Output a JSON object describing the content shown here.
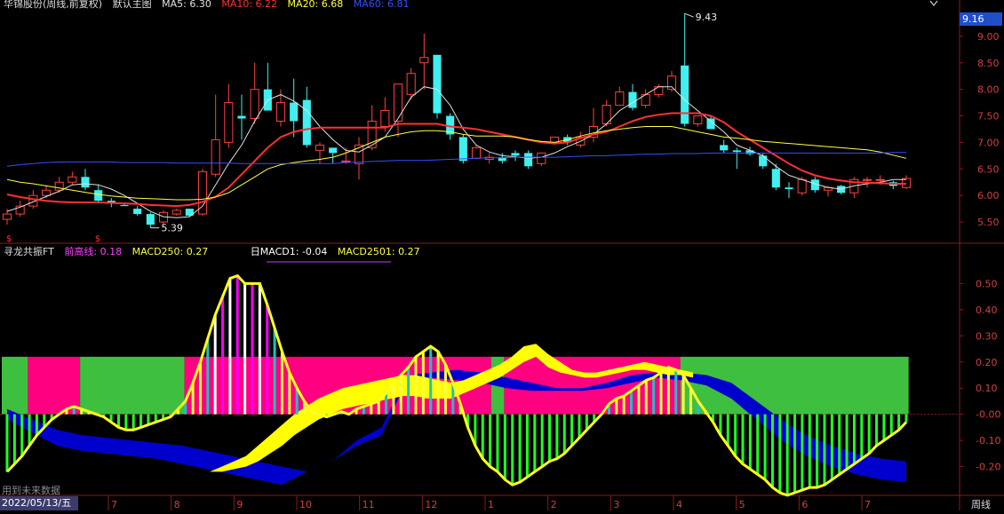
{
  "header": {
    "stock_title": "华锦股份(周线,前复权)",
    "template": "默认主图",
    "ma5": {
      "label": "MA5:",
      "value": "6.30",
      "color": "#e0e0e0"
    },
    "ma10": {
      "label": "MA10:",
      "value": "6.22",
      "color": "#ff3030"
    },
    "ma20": {
      "label": "MA20:",
      "value": "6.68",
      "color": "#ffff40"
    },
    "ma60": {
      "label": "MA60:",
      "value": "6.81",
      "color": "#3050ff"
    }
  },
  "indicator_header": {
    "name": "寻龙共振FT",
    "prev_high": {
      "label": "前高线:",
      "value": "0.18",
      "color": "#ff40ff"
    },
    "macd250": {
      "label": "MACD250:",
      "value": "0.27",
      "color": "#ffff40"
    },
    "day_macd1": {
      "label": "日MACD1:",
      "value": "-0.04",
      "color": "#ffffff"
    },
    "macd2501": {
      "label": "MACD2501:",
      "value": "0.27",
      "color": "#ffff40"
    }
  },
  "price_badge": "9.16",
  "axis_title": "周线",
  "date_box": "2022/05/13/五",
  "future_note": "用到未来数据",
  "marker_s": "$",
  "month_labels": [
    "7",
    "8",
    "9",
    "10",
    "11",
    "12",
    "1",
    "2",
    "3",
    "4",
    "5",
    "6",
    "7"
  ],
  "chart_data": [
    {
      "type": "candlestick",
      "y_ticks": [
        "5.50",
        "6.00",
        "6.50",
        "7.00",
        "7.50",
        "8.00",
        "8.50",
        "9.00"
      ],
      "ylim": [
        5.2,
        9.55
      ],
      "annotations": [
        {
          "text": "9.43",
          "value": 9.43
        },
        {
          "text": "5.39",
          "value": 5.39
        }
      ],
      "candles": [
        {
          "o": 5.55,
          "h": 5.75,
          "l": 5.45,
          "c": 5.65
        },
        {
          "o": 5.65,
          "h": 5.9,
          "l": 5.6,
          "c": 5.8
        },
        {
          "o": 5.8,
          "h": 6.1,
          "l": 5.75,
          "c": 6.0
        },
        {
          "o": 6.0,
          "h": 6.2,
          "l": 5.95,
          "c": 6.1
        },
        {
          "o": 6.1,
          "h": 6.35,
          "l": 6.05,
          "c": 6.25
        },
        {
          "o": 6.25,
          "h": 6.45,
          "l": 6.2,
          "c": 6.35
        },
        {
          "o": 6.35,
          "h": 6.5,
          "l": 6.1,
          "c": 6.15
        },
        {
          "o": 6.1,
          "h": 6.2,
          "l": 5.85,
          "c": 5.9
        },
        {
          "o": 5.9,
          "h": 5.95,
          "l": 5.78,
          "c": 5.85
        },
        {
          "o": 5.82,
          "h": 5.85,
          "l": 5.8,
          "c": 5.8
        },
        {
          "o": 5.75,
          "h": 5.8,
          "l": 5.62,
          "c": 5.65
        },
        {
          "o": 5.65,
          "h": 5.68,
          "l": 5.39,
          "c": 5.45
        },
        {
          "o": 5.5,
          "h": 5.72,
          "l": 5.45,
          "c": 5.68
        },
        {
          "o": 5.65,
          "h": 5.75,
          "l": 5.62,
          "c": 5.72
        },
        {
          "o": 5.75,
          "h": 5.75,
          "l": 5.6,
          "c": 5.62
        },
        {
          "o": 5.65,
          "h": 6.5,
          "l": 5.62,
          "c": 6.45
        },
        {
          "o": 6.4,
          "h": 7.9,
          "l": 6.35,
          "c": 7.05
        },
        {
          "o": 7.0,
          "h": 8.1,
          "l": 6.9,
          "c": 7.75
        },
        {
          "o": 7.5,
          "h": 7.9,
          "l": 7.05,
          "c": 7.45
        },
        {
          "o": 7.45,
          "h": 8.5,
          "l": 7.35,
          "c": 8.0
        },
        {
          "o": 8.0,
          "h": 8.5,
          "l": 7.6,
          "c": 7.6
        },
        {
          "o": 7.4,
          "h": 8.0,
          "l": 7.3,
          "c": 7.75
        },
        {
          "o": 7.75,
          "h": 8.2,
          "l": 7.1,
          "c": 7.4
        },
        {
          "o": 7.8,
          "h": 8.05,
          "l": 6.9,
          "c": 6.95
        },
        {
          "o": 6.85,
          "h": 7.0,
          "l": 6.6,
          "c": 6.95
        },
        {
          "o": 6.9,
          "h": 6.9,
          "l": 6.6,
          "c": 6.8
        },
        {
          "o": 6.65,
          "h": 6.9,
          "l": 6.6,
          "c": 6.65
        },
        {
          "o": 6.6,
          "h": 7.1,
          "l": 6.3,
          "c": 6.95
        },
        {
          "o": 6.9,
          "h": 7.7,
          "l": 6.85,
          "c": 7.4
        },
        {
          "o": 7.3,
          "h": 7.85,
          "l": 7.2,
          "c": 7.6
        },
        {
          "o": 7.4,
          "h": 8.1,
          "l": 7.1,
          "c": 8.1
        },
        {
          "o": 7.9,
          "h": 8.4,
          "l": 7.8,
          "c": 8.3
        },
        {
          "o": 8.5,
          "h": 9.05,
          "l": 8.0,
          "c": 8.6
        },
        {
          "o": 8.65,
          "h": 8.65,
          "l": 7.45,
          "c": 7.55
        },
        {
          "o": 7.5,
          "h": 7.55,
          "l": 7.05,
          "c": 7.15
        },
        {
          "o": 7.1,
          "h": 7.15,
          "l": 6.6,
          "c": 6.65
        },
        {
          "o": 6.7,
          "h": 6.95,
          "l": 6.68,
          "c": 6.9
        },
        {
          "o": 6.68,
          "h": 6.8,
          "l": 6.6,
          "c": 6.72
        },
        {
          "o": 6.72,
          "h": 6.8,
          "l": 6.6,
          "c": 6.65
        },
        {
          "o": 6.8,
          "h": 6.85,
          "l": 6.65,
          "c": 6.75
        },
        {
          "o": 6.8,
          "h": 6.85,
          "l": 6.5,
          "c": 6.55
        },
        {
          "o": 6.6,
          "h": 6.8,
          "l": 6.55,
          "c": 6.8
        },
        {
          "o": 7.0,
          "h": 7.1,
          "l": 6.95,
          "c": 7.1
        },
        {
          "o": 7.1,
          "h": 7.15,
          "l": 6.95,
          "c": 7.0
        },
        {
          "o": 6.95,
          "h": 7.2,
          "l": 6.9,
          "c": 7.1
        },
        {
          "o": 7.1,
          "h": 7.65,
          "l": 7.0,
          "c": 7.3
        },
        {
          "o": 7.35,
          "h": 7.8,
          "l": 7.3,
          "c": 7.7
        },
        {
          "o": 7.7,
          "h": 8.05,
          "l": 7.7,
          "c": 7.95
        },
        {
          "o": 7.95,
          "h": 8.1,
          "l": 7.6,
          "c": 7.65
        },
        {
          "o": 7.7,
          "h": 8.0,
          "l": 7.65,
          "c": 7.9
        },
        {
          "o": 7.9,
          "h": 8.1,
          "l": 7.85,
          "c": 8.05
        },
        {
          "o": 8.0,
          "h": 8.35,
          "l": 7.95,
          "c": 8.25
        },
        {
          "o": 8.45,
          "h": 9.43,
          "l": 7.3,
          "c": 7.35
        },
        {
          "o": 7.35,
          "h": 7.5,
          "l": 7.3,
          "c": 7.5
        },
        {
          "o": 7.45,
          "h": 7.5,
          "l": 7.25,
          "c": 7.25
        },
        {
          "o": 6.95,
          "h": 7.05,
          "l": 6.8,
          "c": 6.85
        },
        {
          "o": 6.85,
          "h": 6.9,
          "l": 6.5,
          "c": 6.82
        },
        {
          "o": 6.85,
          "h": 6.92,
          "l": 6.75,
          "c": 6.78
        },
        {
          "o": 6.75,
          "h": 6.8,
          "l": 6.5,
          "c": 6.55
        },
        {
          "o": 6.5,
          "h": 6.6,
          "l": 6.1,
          "c": 6.15
        },
        {
          "o": 6.15,
          "h": 6.25,
          "l": 5.95,
          "c": 6.12
        },
        {
          "o": 6.05,
          "h": 6.35,
          "l": 6.0,
          "c": 6.3
        },
        {
          "o": 6.3,
          "h": 6.35,
          "l": 6.05,
          "c": 6.1
        },
        {
          "o": 6.1,
          "h": 6.18,
          "l": 5.98,
          "c": 6.15
        },
        {
          "o": 6.18,
          "h": 6.2,
          "l": 6.02,
          "c": 6.05
        },
        {
          "o": 6.05,
          "h": 6.35,
          "l": 5.95,
          "c": 6.3
        },
        {
          "o": 6.3,
          "h": 6.35,
          "l": 6.15,
          "c": 6.3
        },
        {
          "o": 6.3,
          "h": 6.38,
          "l": 6.2,
          "c": 6.3
        },
        {
          "o": 6.25,
          "h": 6.28,
          "l": 6.12,
          "c": 6.18
        },
        {
          "o": 6.15,
          "h": 6.38,
          "l": 6.12,
          "c": 6.32
        }
      ],
      "series": [
        {
          "name": "MA5",
          "color": "#e0e0e0",
          "values": [
            5.7,
            5.78,
            5.88,
            5.98,
            6.08,
            6.2,
            6.22,
            6.2,
            6.12,
            6.0,
            5.85,
            5.7,
            5.6,
            5.58,
            5.6,
            5.8,
            6.2,
            6.6,
            6.95,
            7.4,
            7.8,
            7.9,
            7.78,
            7.6,
            7.3,
            7.05,
            6.85,
            6.82,
            6.95,
            7.1,
            7.45,
            7.85,
            8.05,
            8.0,
            7.7,
            7.25,
            6.95,
            6.82,
            6.75,
            6.73,
            6.7,
            6.72,
            6.8,
            6.92,
            7.02,
            7.15,
            7.35,
            7.6,
            7.75,
            7.9,
            8.05,
            8.05,
            7.8,
            7.6,
            7.4,
            7.2,
            6.95,
            6.85,
            6.75,
            6.55,
            6.38,
            6.3,
            6.22,
            6.15,
            6.12,
            6.18,
            6.22,
            6.25,
            6.3,
            6.3
          ]
        },
        {
          "name": "MA10",
          "color": "#ff3030",
          "values": [
            6.02,
            5.97,
            5.93,
            5.9,
            5.88,
            5.87,
            5.87,
            5.87,
            5.86,
            5.85,
            5.84,
            5.82,
            5.81,
            5.8,
            5.82,
            5.88,
            5.98,
            6.15,
            6.4,
            6.65,
            6.9,
            7.1,
            7.2,
            7.25,
            7.28,
            7.28,
            7.28,
            7.28,
            7.28,
            7.28,
            7.35,
            7.35,
            7.35,
            7.35,
            7.3,
            7.28,
            7.25,
            7.2,
            7.15,
            7.1,
            7.05,
            7.0,
            6.98,
            7.0,
            7.08,
            7.15,
            7.2,
            7.3,
            7.4,
            7.48,
            7.52,
            7.55,
            7.55,
            7.55,
            7.5,
            7.38,
            7.2,
            7.05,
            6.9,
            6.75,
            6.6,
            6.47,
            6.38,
            6.32,
            6.28,
            6.25,
            6.24,
            6.23,
            6.22,
            6.22
          ]
        },
        {
          "name": "MA20",
          "color": "#ffff40",
          "values": [
            6.3,
            6.25,
            6.22,
            6.18,
            6.14,
            6.1,
            6.06,
            6.02,
            5.99,
            5.97,
            5.95,
            5.94,
            5.93,
            5.92,
            5.92,
            5.93,
            5.97,
            6.05,
            6.2,
            6.35,
            6.5,
            6.58,
            6.62,
            6.65,
            6.68,
            6.72,
            6.8,
            6.9,
            7.0,
            7.1,
            7.15,
            7.2,
            7.22,
            7.22,
            7.2,
            7.15,
            7.12,
            7.12,
            7.12,
            7.1,
            7.05,
            7.02,
            7.0,
            7.05,
            7.12,
            7.18,
            7.22,
            7.25,
            7.28,
            7.3,
            7.3,
            7.3,
            7.25,
            7.2,
            7.15,
            7.1,
            7.08,
            7.05,
            7.02,
            7.0,
            6.98,
            6.96,
            6.94,
            6.92,
            6.9,
            6.88,
            6.86,
            6.82,
            6.76,
            6.7
          ]
        },
        {
          "name": "MA60",
          "color": "#3050ff",
          "values": [
            6.55,
            6.58,
            6.6,
            6.62,
            6.63,
            6.63,
            6.63,
            6.63,
            6.63,
            6.62,
            6.62,
            6.62,
            6.62,
            6.61,
            6.61,
            6.61,
            6.61,
            6.61,
            6.6,
            6.6,
            6.6,
            6.6,
            6.6,
            6.6,
            6.6,
            6.6,
            6.62,
            6.63,
            6.64,
            6.65,
            6.66,
            6.66,
            6.66,
            6.67,
            6.68,
            6.69,
            6.7,
            6.71,
            6.71,
            6.72,
            6.72,
            6.72,
            6.72,
            6.73,
            6.74,
            6.75,
            6.75,
            6.76,
            6.77,
            6.78,
            6.78,
            6.79,
            6.79,
            6.79,
            6.8,
            6.8,
            6.8,
            6.8,
            6.8,
            6.8,
            6.8,
            6.8,
            6.8,
            6.8,
            6.8,
            6.8,
            6.8,
            6.8,
            6.81,
            6.81
          ]
        }
      ]
    },
    {
      "type": "indicator",
      "y_ticks": [
        "0.50",
        "0.40",
        "0.30",
        "0.20",
        "0.10",
        "-0.00",
        "-0.10",
        "-0.20"
      ],
      "ylim": [
        -0.3,
        0.6
      ],
      "bands": [
        {
          "from": 0,
          "to": 4,
          "color": "#3fbf3f"
        },
        {
          "from": 4,
          "to": 12,
          "color": "#ff0080"
        },
        {
          "from": 12,
          "to": 28,
          "color": "#3fbf3f"
        },
        {
          "from": 28,
          "to": 75,
          "color": "#ff0080"
        },
        {
          "from": 75,
          "to": 77,
          "color": "#3fbf3f"
        },
        {
          "from": 77,
          "to": 104,
          "color": "#ff0080"
        },
        {
          "from": 104,
          "to": 139,
          "color": "#3fbf3f"
        }
      ],
      "band_top": 0.22,
      "yellow_line": [
        -0.22,
        -0.19,
        -0.16,
        -0.12,
        -0.08,
        -0.05,
        -0.02,
        0.0,
        0.02,
        0.03,
        0.02,
        0.01,
        0.0,
        -0.01,
        -0.03,
        -0.05,
        -0.06,
        -0.06,
        -0.05,
        -0.04,
        -0.03,
        -0.02,
        -0.01,
        0.02,
        0.05,
        0.12,
        0.2,
        0.29,
        0.38,
        0.45,
        0.52,
        0.53,
        0.5,
        0.5,
        0.5,
        0.42,
        0.33,
        0.24,
        0.16,
        0.1,
        0.05,
        0.01,
        0.0,
        -0.01,
        0.0,
        0.01,
        0.0,
        0.02,
        0.03,
        0.04,
        0.05,
        0.08,
        0.12,
        0.15,
        0.18,
        0.22,
        0.24,
        0.26,
        0.24,
        0.19,
        0.12,
        0.04,
        -0.05,
        -0.12,
        -0.17,
        -0.2,
        -0.22,
        -0.25,
        -0.27,
        -0.26,
        -0.24,
        -0.22,
        -0.2,
        -0.18,
        -0.17,
        -0.15,
        -0.12,
        -0.09,
        -0.06,
        -0.03,
        0.0,
        0.04,
        0.06,
        0.07,
        0.09,
        0.11,
        0.13,
        0.14,
        0.16,
        0.18,
        0.17,
        0.15,
        0.1,
        0.05,
        0.01,
        -0.03,
        -0.08,
        -0.12,
        -0.16,
        -0.19,
        -0.21,
        -0.23,
        -0.25,
        -0.28,
        -0.3,
        -0.31,
        -0.3,
        -0.29,
        -0.28,
        -0.28,
        -0.27,
        -0.25,
        -0.23,
        -0.21,
        -0.19,
        -0.17,
        -0.15,
        -0.12,
        -0.1,
        -0.08,
        -0.06,
        -0.03
      ],
      "yellow_band_upper": [
        -0.22,
        -0.2,
        -0.18,
        -0.16,
        -0.12,
        -0.08,
        -0.04,
        0.0,
        0.03,
        0.06,
        0.08,
        0.1,
        0.11,
        0.12,
        0.13,
        0.14,
        0.15,
        0.15,
        0.14,
        0.13,
        0.12,
        0.13,
        0.15,
        0.17,
        0.19,
        0.22,
        0.26,
        0.27,
        0.23,
        0.2,
        0.17,
        0.16,
        0.16,
        0.17,
        0.18,
        0.19,
        0.2,
        0.19,
        0.18,
        0.17,
        0.16
      ],
      "yellow_band_lower": [
        -0.22,
        -0.22,
        -0.21,
        -0.2,
        -0.18,
        -0.15,
        -0.12,
        -0.08,
        -0.05,
        -0.02,
        0.0,
        0.02,
        0.03,
        0.04,
        0.05,
        0.06,
        0.07,
        0.07,
        0.06,
        0.06,
        0.06,
        0.08,
        0.1,
        0.12,
        0.14,
        0.17,
        0.2,
        0.22,
        0.18,
        0.16,
        0.15,
        0.14,
        0.14,
        0.15,
        0.16,
        0.17,
        0.17,
        0.16,
        0.15,
        0.15,
        0.14
      ],
      "blue_band_upper": [
        0.02,
        -0.02,
        -0.06,
        -0.08,
        -0.09,
        -0.1,
        -0.11,
        -0.12,
        -0.14,
        -0.16,
        -0.18,
        -0.2,
        -0.22,
        -0.18,
        -0.1,
        -0.05,
        0.15,
        0.16,
        0.17,
        0.16,
        0.14,
        0.12,
        0.1,
        0.1,
        0.12,
        0.15,
        0.16,
        0.16,
        0.15,
        0.12,
        0.05,
        -0.02,
        -0.08,
        -0.12,
        -0.15,
        -0.17,
        -0.18
      ],
      "blue_band_lower": [
        -0.02,
        -0.07,
        -0.12,
        -0.14,
        -0.15,
        -0.16,
        -0.17,
        -0.19,
        -0.21,
        -0.23,
        -0.25,
        -0.27,
        -0.22,
        -0.18,
        -0.12,
        -0.08,
        0.13,
        0.14,
        0.13,
        0.12,
        0.1,
        0.09,
        0.09,
        0.09,
        0.1,
        0.12,
        0.14,
        0.13,
        0.11,
        0.06,
        -0.02,
        -0.1,
        -0.16,
        -0.2,
        -0.23,
        -0.25,
        -0.26
      ]
    }
  ]
}
